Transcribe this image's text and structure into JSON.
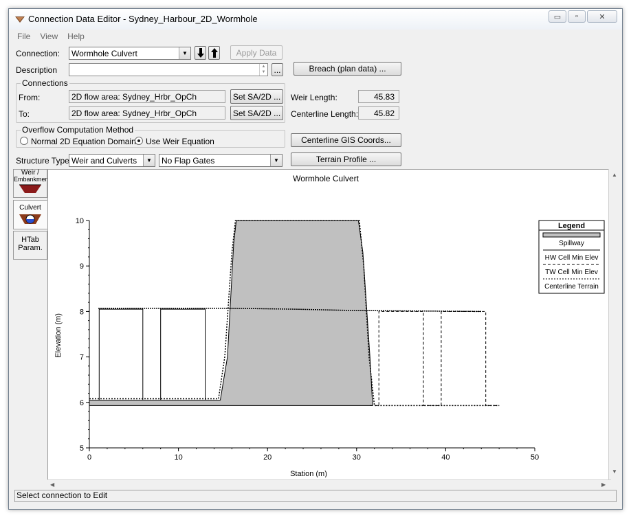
{
  "window": {
    "title": "Connection Data Editor - Sydney_Harbour_2D_Wormhole",
    "minimize_glyph": "▭",
    "restore_glyph": "▫",
    "close_glyph": "✕"
  },
  "menu": [
    "File",
    "View",
    "Help"
  ],
  "form": {
    "connection_label": "Connection:",
    "connection_value": "Wormhole Culvert",
    "apply_label": "Apply Data",
    "description_label": "Description",
    "description_value": "",
    "ellipsis": "...",
    "breach_label": "Breach (plan data) ...",
    "connections_group": "Connections",
    "from_label": "From:",
    "from_value": "2D flow area: Sydney_Hrbr_OpCh",
    "to_label": "To:",
    "to_value": "2D flow area: Sydney_Hrbr_OpCh",
    "set_label": "Set SA/2D ...",
    "weir_length_label": "Weir Length:",
    "weir_length_value": "45.83",
    "centerline_length_label": "Centerline Length:",
    "centerline_length_value": "45.82",
    "overflow_group": "Overflow Computation Method",
    "radio_normal": "Normal 2D Equation Domain",
    "radio_weir": "Use Weir Equation",
    "selected_method": "weir",
    "gis_label": "Centerline GIS Coords...",
    "structure_type_label": "Structure Type:",
    "structure_type_value": "Weir and Culverts",
    "flap_value": "No Flap Gates",
    "terrain_label": "Terrain Profile ..."
  },
  "side_tabs": [
    {
      "label1": "Weir /",
      "label2": "Embankment"
    },
    {
      "label1": "Culvert",
      "label2": ""
    },
    {
      "label1": "HTab",
      "label2": "Param."
    }
  ],
  "status": "Select connection to Edit",
  "chart_data": {
    "type": "line",
    "title": "Wormhole Culvert",
    "xlabel": "Station (m)",
    "ylabel": "Elevation (m)",
    "xlim": [
      0,
      50
    ],
    "ylim": [
      5,
      10
    ],
    "xticks": [
      0,
      10,
      20,
      30,
      40,
      50
    ],
    "yticks": [
      5,
      6,
      7,
      8,
      9,
      10
    ],
    "legend_title": "Legend",
    "legend": [
      "Spillway",
      "HW Cell Min Elev",
      "TW Cell Min Elev",
      "Centerline Terrain"
    ],
    "colors": {
      "spillway_fill": "#c0c0c0",
      "line": "#000000"
    },
    "spillway": {
      "x": [
        0,
        14.7,
        15.5,
        16.2,
        16.5,
        30.2,
        30.7,
        31.5,
        31.8,
        0
      ],
      "y": [
        6.05,
        6.05,
        7.0,
        9.5,
        10.0,
        10.0,
        9.3,
        7.0,
        5.93,
        5.93
      ]
    },
    "hw_cell_min_elev": {
      "x": [
        0,
        1.1,
        1.1,
        6.0,
        6.0,
        8.0,
        8.0,
        13.0,
        13.0,
        14.6
      ],
      "y": [
        6.05,
        6.05,
        8.05,
        8.05,
        6.05,
        6.05,
        8.05,
        8.05,
        6.05,
        6.05
      ]
    },
    "tw_cell_min_elev": {
      "x": [
        31.5,
        32.5,
        32.5,
        37.5,
        37.5,
        39.5,
        39.5,
        44.5,
        44.5,
        46
      ],
      "y": [
        5.93,
        5.93,
        8.0,
        8.0,
        5.93,
        5.93,
        8.0,
        8.0,
        5.93,
        5.93
      ]
    },
    "centerline_terrain": {
      "x": [
        0,
        14.5,
        15.2,
        16.0,
        16.4,
        30.3,
        30.8,
        31.4,
        32,
        46
      ],
      "y": [
        6.08,
        6.08,
        7.0,
        9.3,
        10.0,
        10.0,
        9.0,
        7.0,
        5.93,
        5.93
      ]
    },
    "water_line": {
      "x": [
        1,
        16,
        23,
        30,
        44
      ],
      "y": [
        8.07,
        8.07,
        8.05,
        8.02,
        8.0
      ]
    }
  }
}
